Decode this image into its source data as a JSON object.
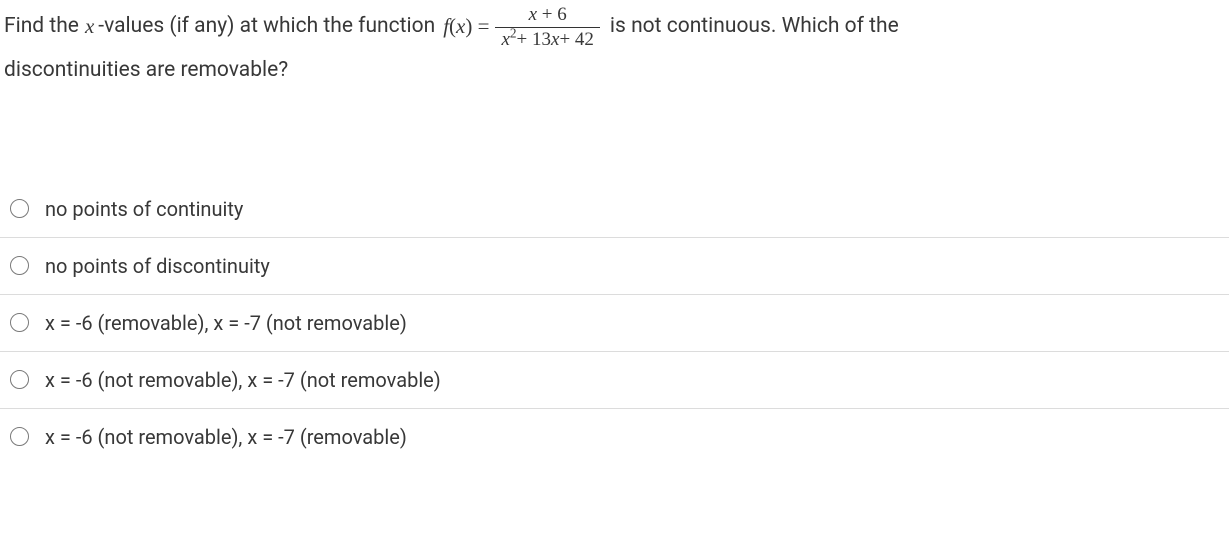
{
  "question": {
    "prefix1": "Find the",
    "var_x": "x",
    "prefix2": "-values (if any) at which the function",
    "func_label": "f(x) =",
    "numerator": "x + 6",
    "denominator_a": "x",
    "denominator_exp": "2",
    "denominator_b": "+ 13x + 42",
    "suffix1": "is not continuous. Which of the",
    "line2": "discontinuities are removable?"
  },
  "options": [
    {
      "text": "no points of continuity",
      "math": false
    },
    {
      "text": "no points of discontinuity",
      "math": false
    },
    {
      "text": "x  =  -6  (removable), x  =  -7  (not removable)",
      "math": true
    },
    {
      "text": "x  =  -6  (not removable), x  =  -7  (not removable)",
      "math": true
    },
    {
      "text": "x  =  -6 (not removable), x  =  -7  (removable)",
      "math": true
    }
  ]
}
